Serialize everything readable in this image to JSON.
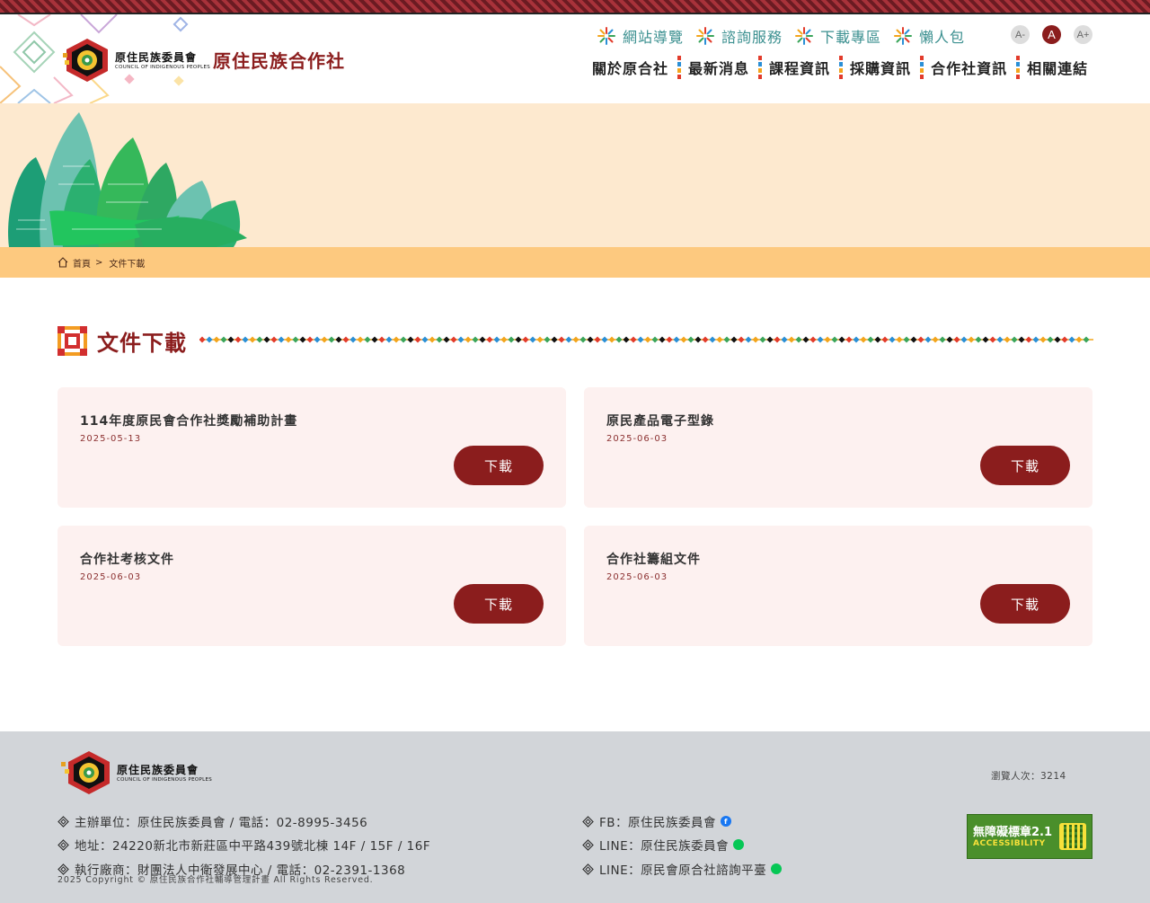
{
  "header": {
    "org_logo_zh": "原住民族委員會",
    "org_logo_en": "COUNCIL OF INDIGENOUS PEOPLES",
    "site_name": "原住民族合作社",
    "utility_links": [
      {
        "label": "網站導覽",
        "icon": "sun-pattern-icon"
      },
      {
        "label": "諮詢服務",
        "icon": "sun-pattern-icon"
      },
      {
        "label": "下載專區",
        "icon": "sun-pattern-icon"
      },
      {
        "label": "懶人包",
        "icon": "sun-pattern-icon"
      }
    ],
    "font_size_buttons": [
      "A-",
      "A",
      "A+"
    ],
    "main_nav": [
      "關於原合社",
      "最新消息",
      "課程資訊",
      "採購資訊",
      "合作社資訊",
      "相關連結"
    ]
  },
  "breadcrumb": {
    "home": "首頁",
    "separator": ">",
    "current": "文件下載"
  },
  "page": {
    "title": "文件下載"
  },
  "documents": [
    {
      "title": "114年度原民會合作社獎勵補助計畫",
      "date": "2025-05-13",
      "button": "下載"
    },
    {
      "title": "原民產品電子型錄",
      "date": "2025-06-03",
      "button": "下載"
    },
    {
      "title": "合作社考核文件",
      "date": "2025-06-03",
      "button": "下載"
    },
    {
      "title": "合作社籌組文件",
      "date": "2025-06-03",
      "button": "下載"
    }
  ],
  "footer": {
    "org_logo_zh": "原住民族委員會",
    "org_logo_en": "COUNCIL OF INDIGENOUS PEOPLES",
    "lines_left": [
      "主辦單位：原住民族委員會 / 電話：02-8995-3456",
      "地址：24220新北市新莊區中平路439號北棟 14F / 15F / 16F",
      "執行廠商：財團法人中衛發展中心 / 電話：02-2391-1368"
    ],
    "lines_right": [
      {
        "text": "FB：原住民族委員會",
        "icon": "facebook-icon"
      },
      {
        "text": "LINE：原住民族委員會",
        "icon": "line-icon"
      },
      {
        "text": "LINE：原民會原合社諮詢平臺",
        "icon": "line-icon"
      }
    ],
    "copyright": "2025 Copyright © 原住民族合作社輔導管理計畫 All Rights Reserved.",
    "visitors": "瀏覽人次：3214",
    "badge_title": "無障礙標章2.1",
    "badge_sub": "ACCESSIBILITY"
  },
  "colors": {
    "brand": "#8b1d1d",
    "teal": "#3a8f8f",
    "banner_bg": "#fde9cf",
    "breadcrumb_bg": "#fdc97f",
    "card_bg": "#fdf1f0",
    "footer_bg": "#d2d5d9"
  }
}
